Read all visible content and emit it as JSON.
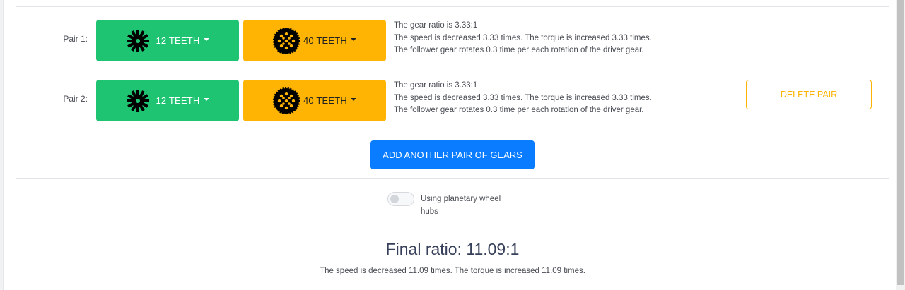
{
  "pairs": [
    {
      "label": "Pair 1:",
      "driver": {
        "label": "12 TEETH",
        "icon": "small-gear-icon"
      },
      "follower": {
        "label": "40 TEETH",
        "icon": "large-gear-icon"
      },
      "ratio_text": "The gear ratio is 3.33:1",
      "speed_text": "The speed is decreased 3.33 times. The torque is increased 3.33 times.",
      "rotation_text": "The follower gear rotates 0.3 time per each rotation of the driver gear."
    },
    {
      "label": "Pair 2:",
      "driver": {
        "label": "12 TEETH",
        "icon": "small-gear-icon"
      },
      "follower": {
        "label": "40 TEETH",
        "icon": "large-gear-icon"
      },
      "ratio_text": "The gear ratio is 3.33:1",
      "speed_text": "The speed is decreased 3.33 times. The torque is increased 3.33 times.",
      "rotation_text": "The follower gear rotates 0.3 time per each rotation of the driver gear.",
      "delete_label": "DELETE PAIR"
    }
  ],
  "add_button_label": "ADD ANOTHER PAIR OF GEARS",
  "planetary": {
    "label": "Using planetary wheel hubs",
    "enabled": false
  },
  "final": {
    "title": "Final ratio: 11.09:1",
    "description": "The speed is decreased 11.09 times. The torque is increased 11.09 times."
  },
  "colors": {
    "driver_button": "#1ec472",
    "follower_button": "#ffb403",
    "add_button": "#0a7cff",
    "delete_border": "#ffb403"
  }
}
